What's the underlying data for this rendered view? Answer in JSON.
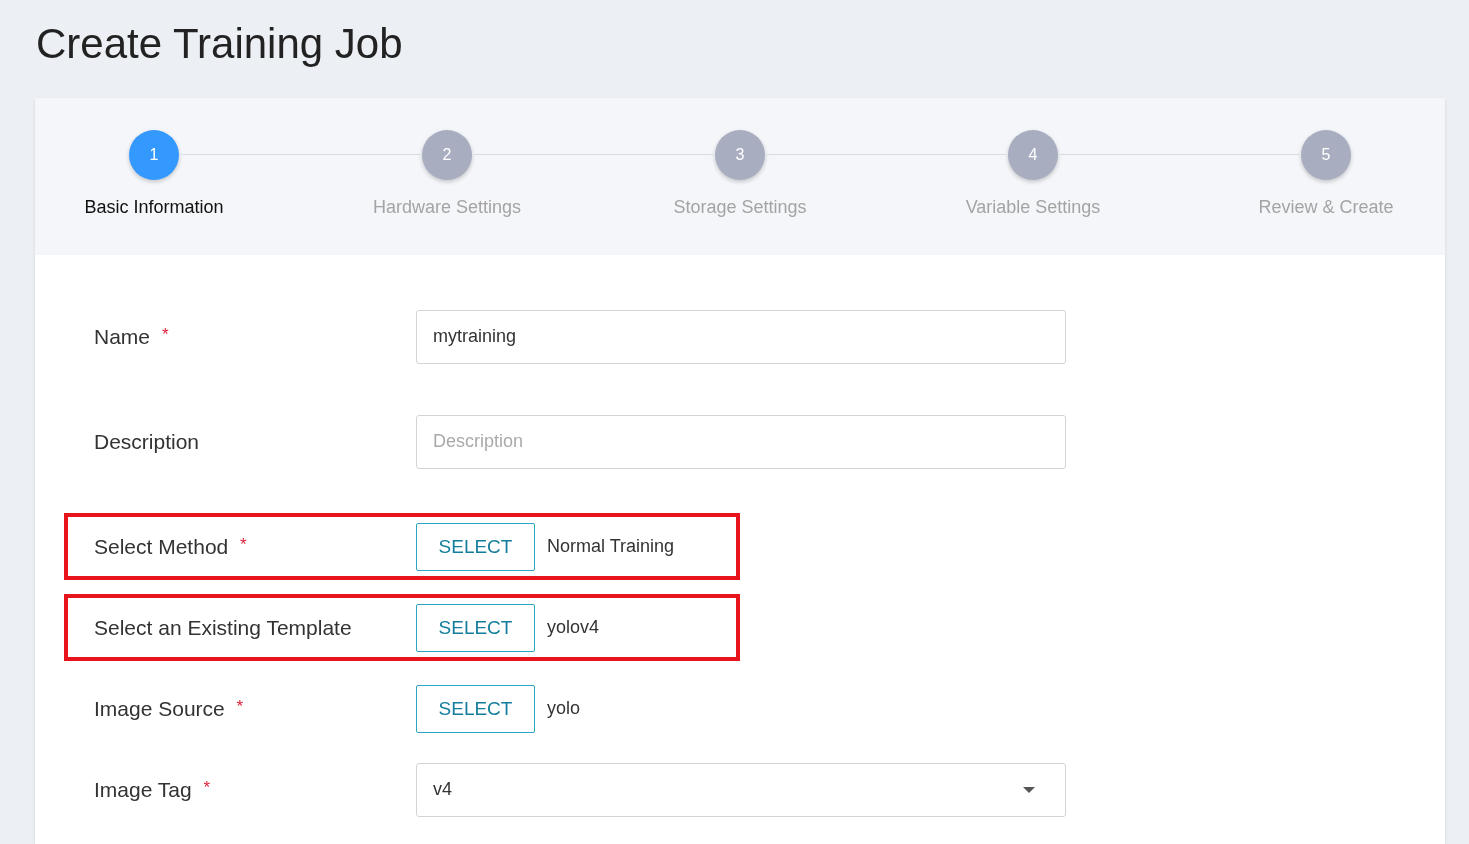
{
  "page": {
    "title": "Create Training Job"
  },
  "steps": [
    {
      "number": "1",
      "label": "Basic Information",
      "selected": true
    },
    {
      "number": "2",
      "label": "Hardware Settings",
      "selected": false
    },
    {
      "number": "3",
      "label": "Storage Settings",
      "selected": false
    },
    {
      "number": "4",
      "label": "Variable Settings",
      "selected": false
    },
    {
      "number": "5",
      "label": "Review & Create",
      "selected": false
    }
  ],
  "fields": [
    {
      "kind": "text",
      "label": "Name",
      "required_mark": "*",
      "value": "mytraining",
      "highlighted": false
    },
    {
      "kind": "text",
      "label": "Description",
      "placeholder": "Description",
      "highlighted": false
    },
    {
      "kind": "select",
      "label": "Select Method",
      "required_mark": "*",
      "button": "SELECT",
      "value": "Normal Training",
      "highlighted": true
    },
    {
      "kind": "select",
      "label": "Select an Existing Template",
      "button": "SELECT",
      "value": "yolov4",
      "highlighted": true
    },
    {
      "kind": "select",
      "label": "Image Source",
      "required_mark": "*",
      "button": "SELECT",
      "value": "yolo",
      "highlighted": false
    },
    {
      "kind": "dropdown",
      "label": "Image Tag",
      "required_mark": "*",
      "value": "v4",
      "highlighted": false
    }
  ]
}
